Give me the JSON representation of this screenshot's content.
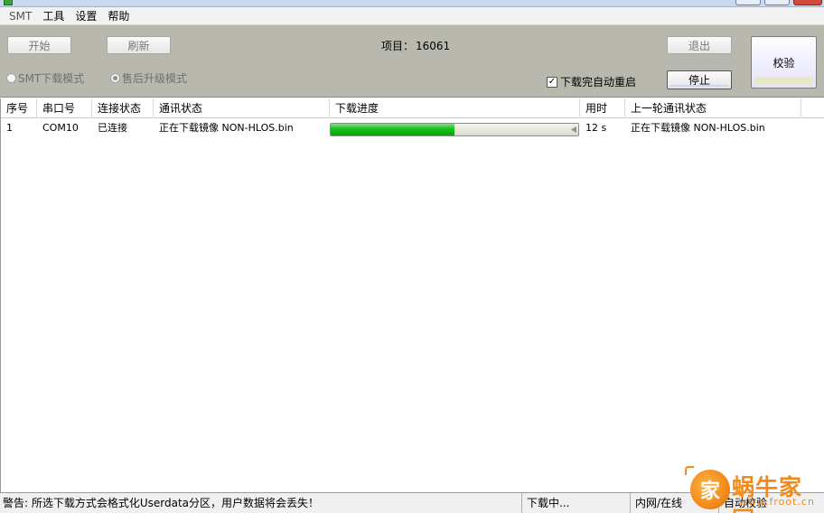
{
  "menu": {
    "items": [
      "SMT",
      "工具",
      "设置",
      "帮助"
    ]
  },
  "toolbar": {
    "start_label": "开始",
    "refresh_label": "刷新",
    "exit_label": "退出",
    "stop_label": "停止",
    "verify_label": "校验",
    "project_label": "项目：",
    "project_value": "16061",
    "mode_smt_label": "SMT下载模式",
    "mode_after_sales_label": "售后升级模式",
    "auto_restart_label": "下载完自动重启",
    "auto_restart_checked": true
  },
  "table": {
    "headers": [
      "序号",
      "串口号",
      "连接状态",
      "通讯状态",
      "下载进度",
      "用时",
      "上一轮通讯状态"
    ],
    "rows": [
      {
        "index": "1",
        "port": "COM10",
        "connection": "已连接",
        "comm_status": "正在下载镜像 NON-HLOS.bin",
        "progress": 0.5,
        "elapsed": "12 s",
        "last_comm_status": "正在下载镜像 NON-HLOS.bin"
      }
    ]
  },
  "statusbar": {
    "warning": "警告: 所选下载方式会格式化Userdata分区，用户数据将会丢失！",
    "state": "下载中...",
    "network": "内网/在线",
    "verify": "自动校验"
  },
  "watermark": {
    "brand": "蜗牛家园",
    "url": "www.froot.cn"
  },
  "colors": {
    "panel_bg": "#b8b8ae",
    "progress_green": "#16c116",
    "watermark_orange": "#f28a1a"
  }
}
